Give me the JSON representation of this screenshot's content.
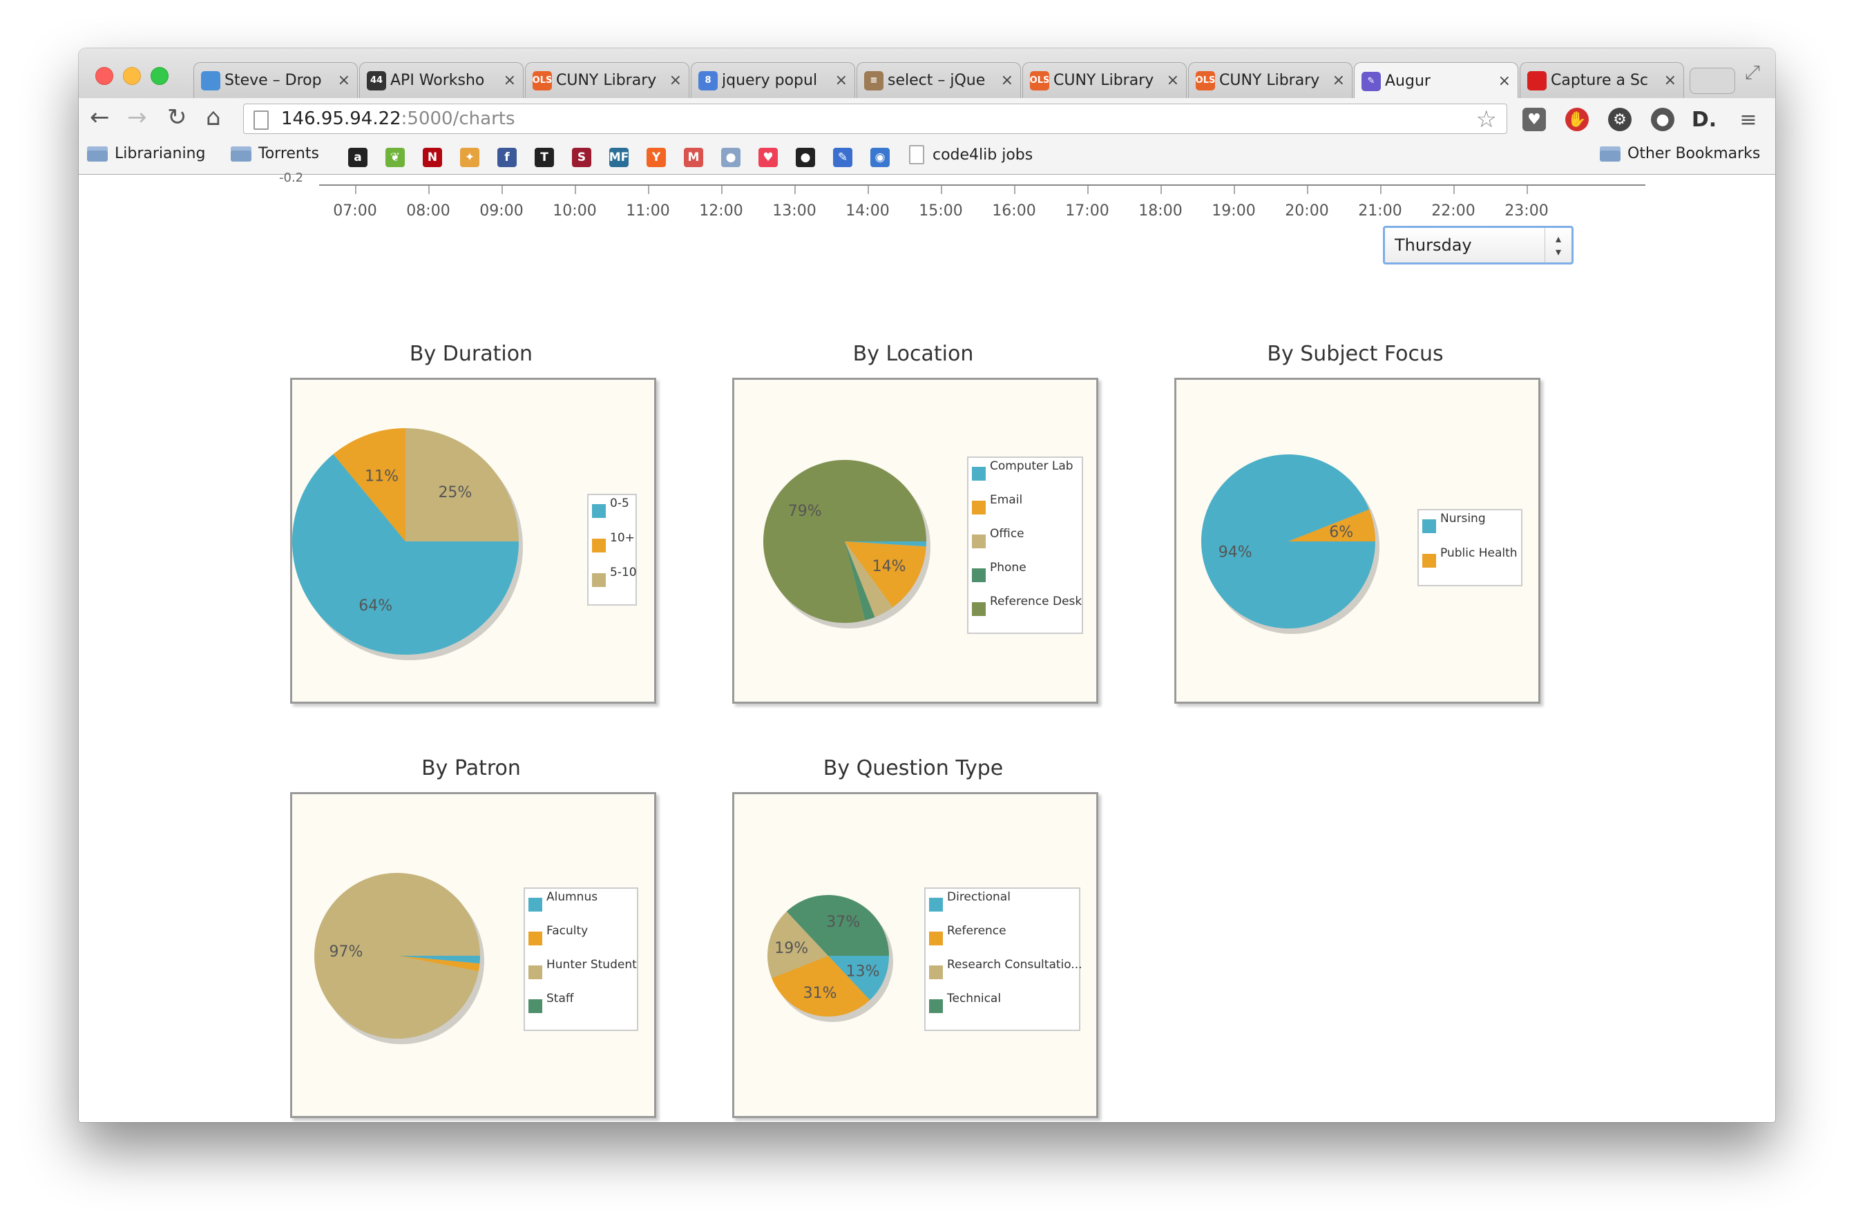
{
  "browser": {
    "tabs": [
      {
        "label": "Steve – Drop",
        "icon": "dropbox-icon",
        "fav_text": "",
        "fav_color": "#4a90d9"
      },
      {
        "label": "API Worksho",
        "icon": "circle-44-icon",
        "fav_text": "44",
        "fav_color": "#333333"
      },
      {
        "label": "CUNY Library",
        "icon": "ols-icon",
        "fav_text": "OLS",
        "fav_color": "#e8632a"
      },
      {
        "label": "jquery popul",
        "icon": "google-icon",
        "fav_text": "8",
        "fav_color": "#4a7fd9"
      },
      {
        "label": "select – jQue",
        "icon": "stackoverflow-icon",
        "fav_text": "≡",
        "fav_color": "#9c7b55"
      },
      {
        "label": "CUNY Library",
        "icon": "ols-icon",
        "fav_text": "OLS",
        "fav_color": "#e8632a"
      },
      {
        "label": "CUNY Library",
        "icon": "ols-icon",
        "fav_text": "OLS",
        "fav_color": "#e8632a"
      },
      {
        "label": "Augur",
        "icon": "augur-icon",
        "fav_text": "✎",
        "fav_color": "#6a5acd",
        "active": true
      },
      {
        "label": "Capture a Sc",
        "icon": "record-icon",
        "fav_text": "",
        "fav_color": "#d81e1e"
      }
    ],
    "tab_close_glyph": "×",
    "url_host": "146.95.94.22",
    "url_path": ":5000/charts",
    "bookmarks": {
      "folder1": "Librarianing",
      "folder2": "Torrents",
      "link": "code4lib jobs",
      "other": "Other Bookmarks",
      "icons": [
        {
          "name": "amazon-icon",
          "text": "a",
          "color": "#222222"
        },
        {
          "name": "leaf-icon",
          "text": "❦",
          "color": "#6fb33a"
        },
        {
          "name": "netflix-icon",
          "text": "N",
          "color": "#b20710"
        },
        {
          "name": "puzzle-icon",
          "text": "✦",
          "color": "#e6a23c"
        },
        {
          "name": "facebook-icon",
          "text": "f",
          "color": "#3b5998"
        },
        {
          "name": "nytimes-icon",
          "text": "T",
          "color": "#222222"
        },
        {
          "name": "slate-icon",
          "text": "S",
          "color": "#9b1b30"
        },
        {
          "name": "mf-icon",
          "text": "MF",
          "color": "#2a6f97"
        },
        {
          "name": "ycombinator-icon",
          "text": "Y",
          "color": "#f26522"
        },
        {
          "name": "gmail-icon",
          "text": "M",
          "color": "#d9534f"
        },
        {
          "name": "reddit-icon",
          "text": "●",
          "color": "#8aa4c8"
        },
        {
          "name": "pocket-icon",
          "text": "♥",
          "color": "#ee4056"
        },
        {
          "name": "github-icon",
          "text": "●",
          "color": "#222222"
        },
        {
          "name": "wand-icon",
          "text": "✎",
          "color": "#3a6fd0"
        },
        {
          "name": "rss-icon",
          "text": "◉",
          "color": "#3a78d0"
        }
      ]
    }
  },
  "timeline": {
    "axis_label": "-0.2",
    "ticks": [
      "07:00",
      "08:00",
      "09:00",
      "10:00",
      "11:00",
      "12:00",
      "13:00",
      "14:00",
      "15:00",
      "16:00",
      "17:00",
      "18:00",
      "19:00",
      "20:00",
      "21:00",
      "22:00",
      "23:00"
    ]
  },
  "day_select": {
    "value": "Thursday"
  },
  "colors": {
    "teal": "#4aafc7",
    "orange": "#eaa227",
    "tan": "#c5b37a",
    "green": "#4e8f6c",
    "olive": "#7f9150",
    "chart_bg": "#fdfbf2"
  },
  "chart_data": [
    {
      "type": "pie",
      "title": "By Duration",
      "slices": [
        {
          "label": "0-5",
          "value": 64,
          "color": "#4aafc7"
        },
        {
          "label": "10+",
          "value": 11,
          "color": "#eaa227"
        },
        {
          "label": "5-10",
          "value": 25,
          "color": "#c5b37a"
        }
      ],
      "legend": [
        "0-5",
        "10+",
        "5-10"
      ],
      "legend_position": "right"
    },
    {
      "type": "pie",
      "title": "By Location",
      "slices": [
        {
          "label": "Computer Lab",
          "value": 1,
          "color": "#4aafc7"
        },
        {
          "label": "Email",
          "value": 14,
          "color": "#eaa227"
        },
        {
          "label": "Office",
          "value": 4,
          "color": "#c5b37a"
        },
        {
          "label": "Phone",
          "value": 2,
          "color": "#4e8f6c"
        },
        {
          "label": "Reference Desk",
          "value": 79,
          "color": "#7f9150"
        }
      ],
      "legend": [
        "Computer Lab",
        "Email",
        "Office",
        "Phone",
        "Reference Desk"
      ],
      "legend_position": "right"
    },
    {
      "type": "pie",
      "title": "By Subject Focus",
      "slices": [
        {
          "label": "Nursing",
          "value": 94,
          "color": "#4aafc7"
        },
        {
          "label": "Public Health",
          "value": 6,
          "color": "#eaa227"
        }
      ],
      "legend": [
        "Nursing",
        "Public Health"
      ],
      "legend_position": "right"
    },
    {
      "type": "pie",
      "title": "By Patron",
      "slices": [
        {
          "label": "Alumnus",
          "value": 1.5,
          "color": "#4aafc7"
        },
        {
          "label": "Faculty",
          "value": 1.5,
          "color": "#eaa227"
        },
        {
          "label": "Hunter Student",
          "value": 97,
          "color": "#c5b37a"
        },
        {
          "label": "Staff",
          "value": 0,
          "color": "#4e8f6c"
        }
      ],
      "legend": [
        "Alumnus",
        "Faculty",
        "Hunter Student",
        "Staff"
      ],
      "legend_position": "right"
    },
    {
      "type": "pie",
      "title": "By Question Type",
      "slices": [
        {
          "label": "Directional",
          "value": 13,
          "color": "#4aafc7"
        },
        {
          "label": "Reference",
          "value": 31,
          "color": "#eaa227"
        },
        {
          "label": "Research Consultatio...",
          "value": 19,
          "color": "#c5b37a"
        },
        {
          "label": "Technical",
          "value": 37,
          "color": "#4e8f6c"
        }
      ],
      "legend": [
        "Directional",
        "Reference",
        "Research Consultatio...",
        "Technical"
      ],
      "legend_position": "right"
    }
  ]
}
